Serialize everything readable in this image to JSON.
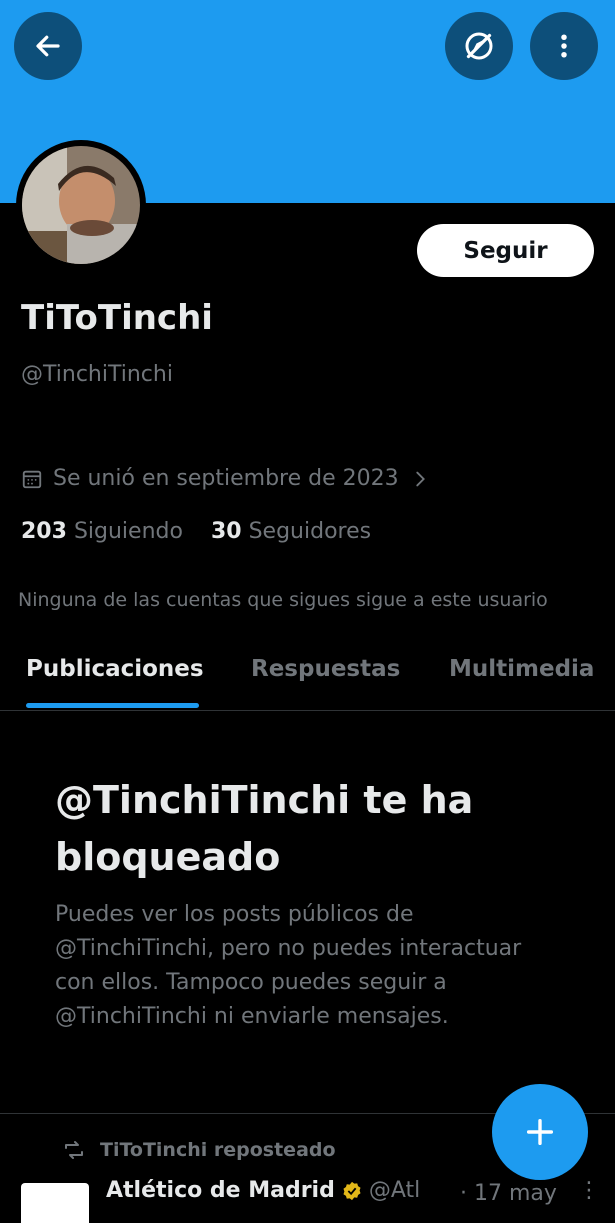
{
  "header": {
    "back_icon": "arrow-left-icon",
    "discover_icon": "compass-slash-icon",
    "more_icon": "more-vertical-icon"
  },
  "profile": {
    "name": "TiToTinchi",
    "handle": "@TinchiTinchi",
    "joined": "Se unió en septiembre de 2023",
    "following_count": "203",
    "following_label": "Siguiendo",
    "followers_count": "30",
    "followers_label": "Seguidores",
    "mutual_note": "Ninguna de las cuentas que sigues sigue a este usuario",
    "follow_label": "Seguir"
  },
  "tabs": [
    {
      "label": "Publicaciones",
      "active": true
    },
    {
      "label": "Respuestas",
      "active": false
    },
    {
      "label": "Multimedia",
      "active": false
    }
  ],
  "blocked": {
    "title": "@TinchiTinchi te ha bloqueado",
    "body": "Puedes ver los posts públicos de @TinchiTinchi, pero no puedes interactuar con ellos. Tampoco puedes seguir a @TinchiTinchi ni enviarle mensajes."
  },
  "post": {
    "repost_label": "TiToTinchi reposteado",
    "author": "Atlético de Madrid",
    "handle": "@Atl",
    "date": "· 17 may"
  },
  "colors": {
    "accent": "#1d9bf0",
    "background": "#000000",
    "muted": "#71767b"
  }
}
